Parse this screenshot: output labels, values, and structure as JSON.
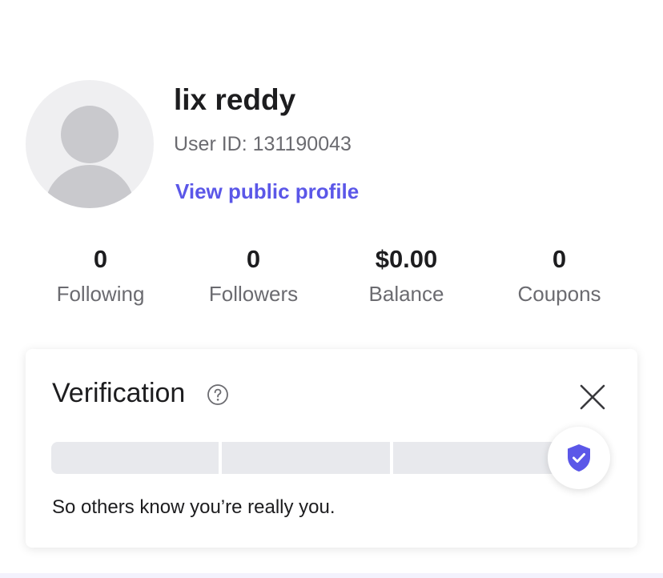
{
  "profile": {
    "name": "lix reddy",
    "user_id_text": "User ID: 131190043",
    "public_profile_link": "View public profile",
    "avatar_icon": "default-user-avatar"
  },
  "stats": [
    {
      "value": "0",
      "label": "Following"
    },
    {
      "value": "0",
      "label": "Followers"
    },
    {
      "value": "$0.00",
      "label": "Balance"
    },
    {
      "value": "0",
      "label": "Coupons"
    }
  ],
  "verification": {
    "title": "Verification",
    "help_icon": "question-circle-icon",
    "close_icon": "close-icon",
    "badge_icon": "shield-check-icon",
    "progress_segments": 3,
    "progress_completed": 0,
    "description": "So others know you’re really you."
  },
  "colors": {
    "accent": "#5b57e8",
    "text_primary": "#1d1d1f",
    "text_secondary": "#6b6b70",
    "avatar_bg": "#efeff1",
    "avatar_fg": "#c9c9cd",
    "progress_track": "#e8e9ed"
  }
}
